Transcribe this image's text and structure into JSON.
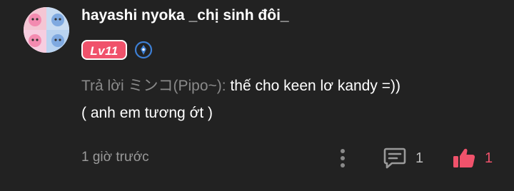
{
  "comment": {
    "username": "hayashi nyoka _chị sinh đôi_",
    "level_label": "Lv11",
    "reply_prefix": "Trả lời ミンコ(Pipo~):",
    "text_line1": "thế cho keen lơ kandy =))",
    "text_line2": "( anh em tương ớt )",
    "timestamp": "1 giờ trước",
    "reply_count": "1",
    "like_count": "1"
  },
  "icons": {
    "avatar": "avatar-image",
    "verified": "verified-badge-icon",
    "more": "more-vertical-icon",
    "reply": "comment-icon",
    "like": "thumbs-up-icon"
  },
  "colors": {
    "background": "#222222",
    "accent": "#f0526b",
    "muted_text": "#8a8a8a",
    "verified_blue": "#3d7fd4"
  }
}
